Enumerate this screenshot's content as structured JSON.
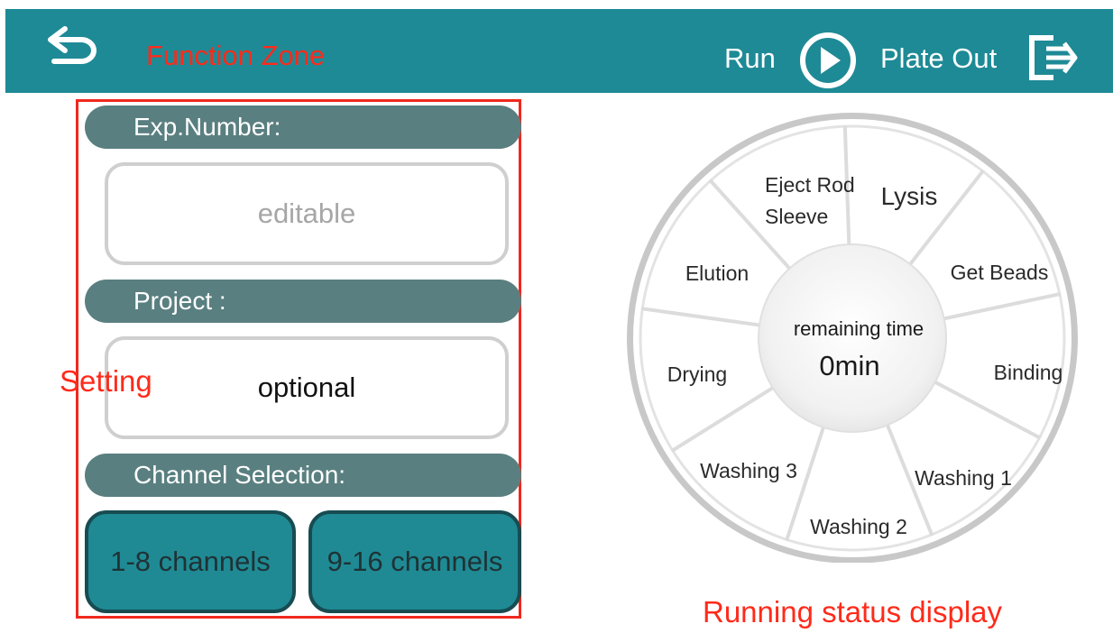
{
  "header": {
    "back_icon": "back-arrow-icon",
    "function_zone_label": "Function Zone",
    "run_label": "Run",
    "run_icon": "play-circle-icon",
    "plate_out_label": "Plate Out",
    "plate_out_icon": "exit-icon"
  },
  "settings": {
    "annotation_label": "Setting",
    "exp_number_label": "Exp.Number:",
    "exp_number_value": "editable",
    "project_label": "Project :",
    "project_value": "optional",
    "channel_selection_label": "Channel Selection:",
    "channel_buttons": [
      "1-8 channels",
      "9-16 channels"
    ]
  },
  "status": {
    "annotation_label": "Running status display",
    "steps": [
      "Lysis",
      "Get Beads",
      "Binding",
      "Washing 1",
      "Washing 2",
      "Washing 3",
      "Drying",
      "Elution",
      "Eject Rod Sleeve"
    ],
    "center_label": "remaining time",
    "remaining_time": "0min"
  },
  "colors": {
    "header_bg": "#1e8a96",
    "section_header_bg": "#5a7f80",
    "channel_button_bg": "#1f8a94",
    "annotation_red": "#ff2a1a"
  }
}
